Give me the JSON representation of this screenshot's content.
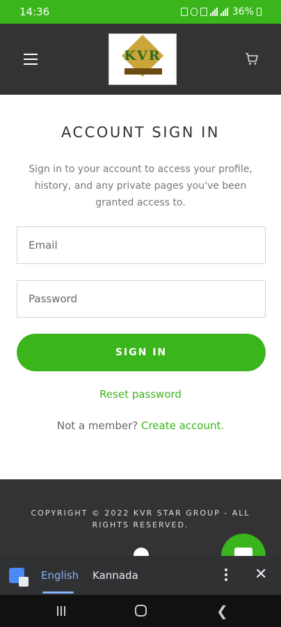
{
  "status_bar": {
    "time": "14:36",
    "battery": "36%"
  },
  "header": {
    "logo_text": "KVR",
    "menu_icon": "hamburger-menu-icon",
    "cart_icon": "shopping-cart-icon"
  },
  "main": {
    "title": "ACCOUNT SIGN IN",
    "subtitle": "Sign in to your account to access your profile, history, and any private pages you've been granted access to.",
    "email_placeholder": "Email",
    "password_placeholder": "Password",
    "signin_label": "SIGN IN",
    "reset_label": "Reset password",
    "member_prefix": "Not a member?",
    "create_account_label": "Create account."
  },
  "footer": {
    "copyright": "COPYRIGHT © 2022 KVR STAR GROUP - ALL RIGHTS RESERVED."
  },
  "translate_bar": {
    "source_lang": "English",
    "target_lang": "Kannada"
  },
  "colors": {
    "accent": "#3ab51c",
    "header_bg": "#333333",
    "translate_bg": "#2f3133"
  }
}
